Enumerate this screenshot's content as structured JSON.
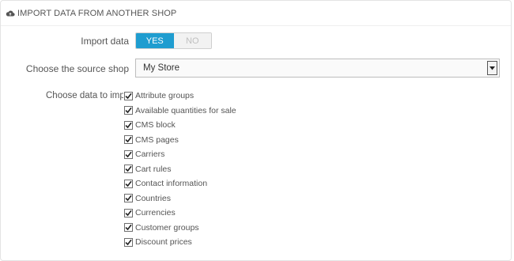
{
  "panel": {
    "title": "IMPORT DATA FROM ANOTHER SHOP",
    "icon": "cloud-upload-icon"
  },
  "import_data": {
    "label": "Import data",
    "yes_label": "YES",
    "no_label": "NO",
    "selected": "YES",
    "accent_color": "#1f9dd0"
  },
  "source_shop": {
    "label": "Choose the source shop",
    "value": "My Store"
  },
  "data_choice": {
    "label": "Choose data to impo",
    "items": [
      {
        "label": "Attribute groups",
        "checked": true
      },
      {
        "label": "Available quantities for sale",
        "checked": true
      },
      {
        "label": "CMS block",
        "checked": true
      },
      {
        "label": "CMS pages",
        "checked": true
      },
      {
        "label": "Carriers",
        "checked": true
      },
      {
        "label": "Cart rules",
        "checked": true
      },
      {
        "label": "Contact information",
        "checked": true
      },
      {
        "label": "Countries",
        "checked": true
      },
      {
        "label": "Currencies",
        "checked": true
      },
      {
        "label": "Customer groups",
        "checked": true
      },
      {
        "label": "Discount prices",
        "checked": true
      }
    ]
  }
}
